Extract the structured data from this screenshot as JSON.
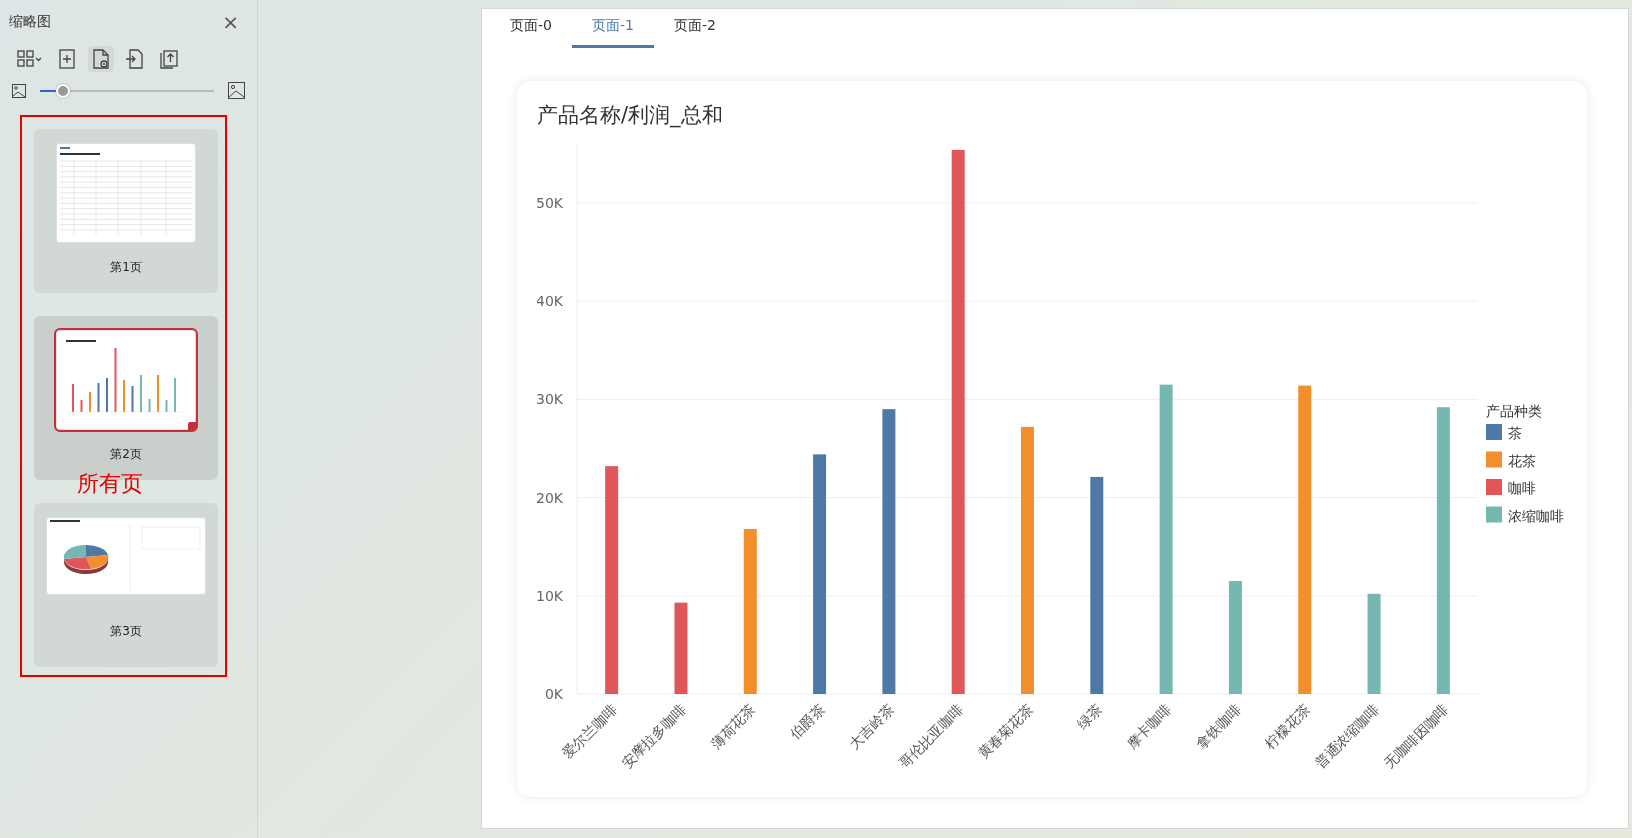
{
  "sidebar": {
    "title": "缩略图",
    "close": "×",
    "toolbar": [
      {
        "kind": "grid",
        "selected": false
      },
      {
        "kind": "add",
        "selected": false
      },
      {
        "kind": "settings",
        "selected": true
      },
      {
        "kind": "export",
        "selected": false
      },
      {
        "kind": "copy",
        "selected": false
      }
    ],
    "zoom_slider": {
      "level": 0.13
    },
    "thumbnails": [
      {
        "kind": "table",
        "label": "第1页",
        "selected": false
      },
      {
        "kind": "bars",
        "label": "第2页",
        "selected": true
      },
      {
        "kind": "pie",
        "label": "第3页",
        "selected": false
      }
    ],
    "annotation": "所有页"
  },
  "tabs": [
    {
      "label": "页面-0",
      "selected": false
    },
    {
      "label": "页面-1",
      "selected": true
    },
    {
      "label": "页面-2",
      "selected": false
    }
  ],
  "chart": {
    "chart_data": {
      "type": "bar",
      "title": "产品名称/利润_总和",
      "categories": [
        "爱尔兰咖啡",
        "安摩拉多咖啡",
        "薄荷花茶",
        "伯爵茶",
        "大吉岭茶",
        "哥伦比亚咖啡",
        "黄春菊花茶",
        "绿茶",
        "摩卡咖啡",
        "拿铁咖啡",
        "柠檬花茶",
        "普通浓缩咖啡",
        "无咖啡因咖啡"
      ],
      "series": [
        {
          "name": "茶",
          "color": "#4e79a7",
          "values": [
            null,
            null,
            null,
            24400,
            29000,
            null,
            null,
            22100,
            null,
            null,
            null,
            null,
            null
          ]
        },
        {
          "name": "花茶",
          "color": "#f28e2b",
          "values": [
            null,
            null,
            16800,
            null,
            null,
            null,
            27200,
            null,
            null,
            null,
            31400,
            null,
            null
          ]
        },
        {
          "name": "咖啡",
          "color": "#e15759",
          "values": [
            23200,
            9300,
            null,
            null,
            null,
            55400,
            null,
            null,
            null,
            null,
            null,
            null,
            null
          ]
        },
        {
          "name": "浓缩咖啡",
          "color": "#76b7b2",
          "values": [
            null,
            null,
            null,
            null,
            null,
            null,
            null,
            null,
            31500,
            11500,
            null,
            10200,
            29200
          ]
        }
      ],
      "ylim": [
        0,
        56000
      ],
      "yticks": [
        {
          "value": 0,
          "label": "0K"
        },
        {
          "value": 10000,
          "label": "10K"
        },
        {
          "value": 20000,
          "label": "20K"
        },
        {
          "value": 30000,
          "label": "30K"
        },
        {
          "value": 40000,
          "label": "40K"
        },
        {
          "value": 50000,
          "label": "50K"
        }
      ],
      "grid": true,
      "legend": {
        "title": "产品种类"
      }
    }
  }
}
